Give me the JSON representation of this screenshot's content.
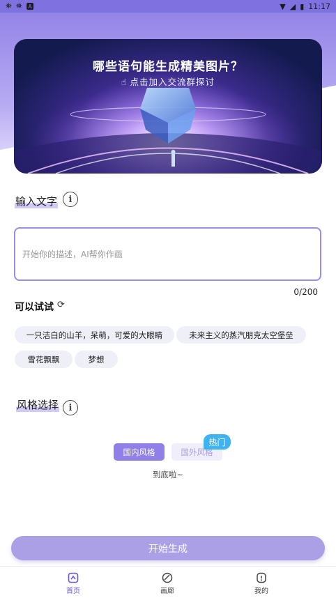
{
  "status_bar": {
    "left_icons": [
      "bug-icon",
      "bug-icon",
      "a-icon"
    ],
    "time": "11:17"
  },
  "banner": {
    "title": "哪些语句能生成精美图片？",
    "subtitle": "点击加入交流群探讨"
  },
  "input_section": {
    "label": "输入文字",
    "placeholder": "开始你的描述，AI帮你作画",
    "counter": "0/200"
  },
  "suggestions": {
    "title": "可以试试",
    "chips": [
      "一只洁白的山羊，呆萌，可爱的大眼睛",
      "未来主义的蒸汽朋克太空堡垒",
      "雪花飘飘",
      "梦想"
    ]
  },
  "style_section": {
    "label": "风格选择",
    "tabs": [
      "国内风格",
      "国外风格"
    ],
    "hot_badge": "热门",
    "end_text": "到底啦~"
  },
  "generate_button": "开始生成",
  "bottom_nav": [
    "首页",
    "画廊",
    "我的"
  ],
  "colors": {
    "accent": "#8f7fe6",
    "button": "#ab9fe6",
    "hot": "#3fb3ef"
  }
}
